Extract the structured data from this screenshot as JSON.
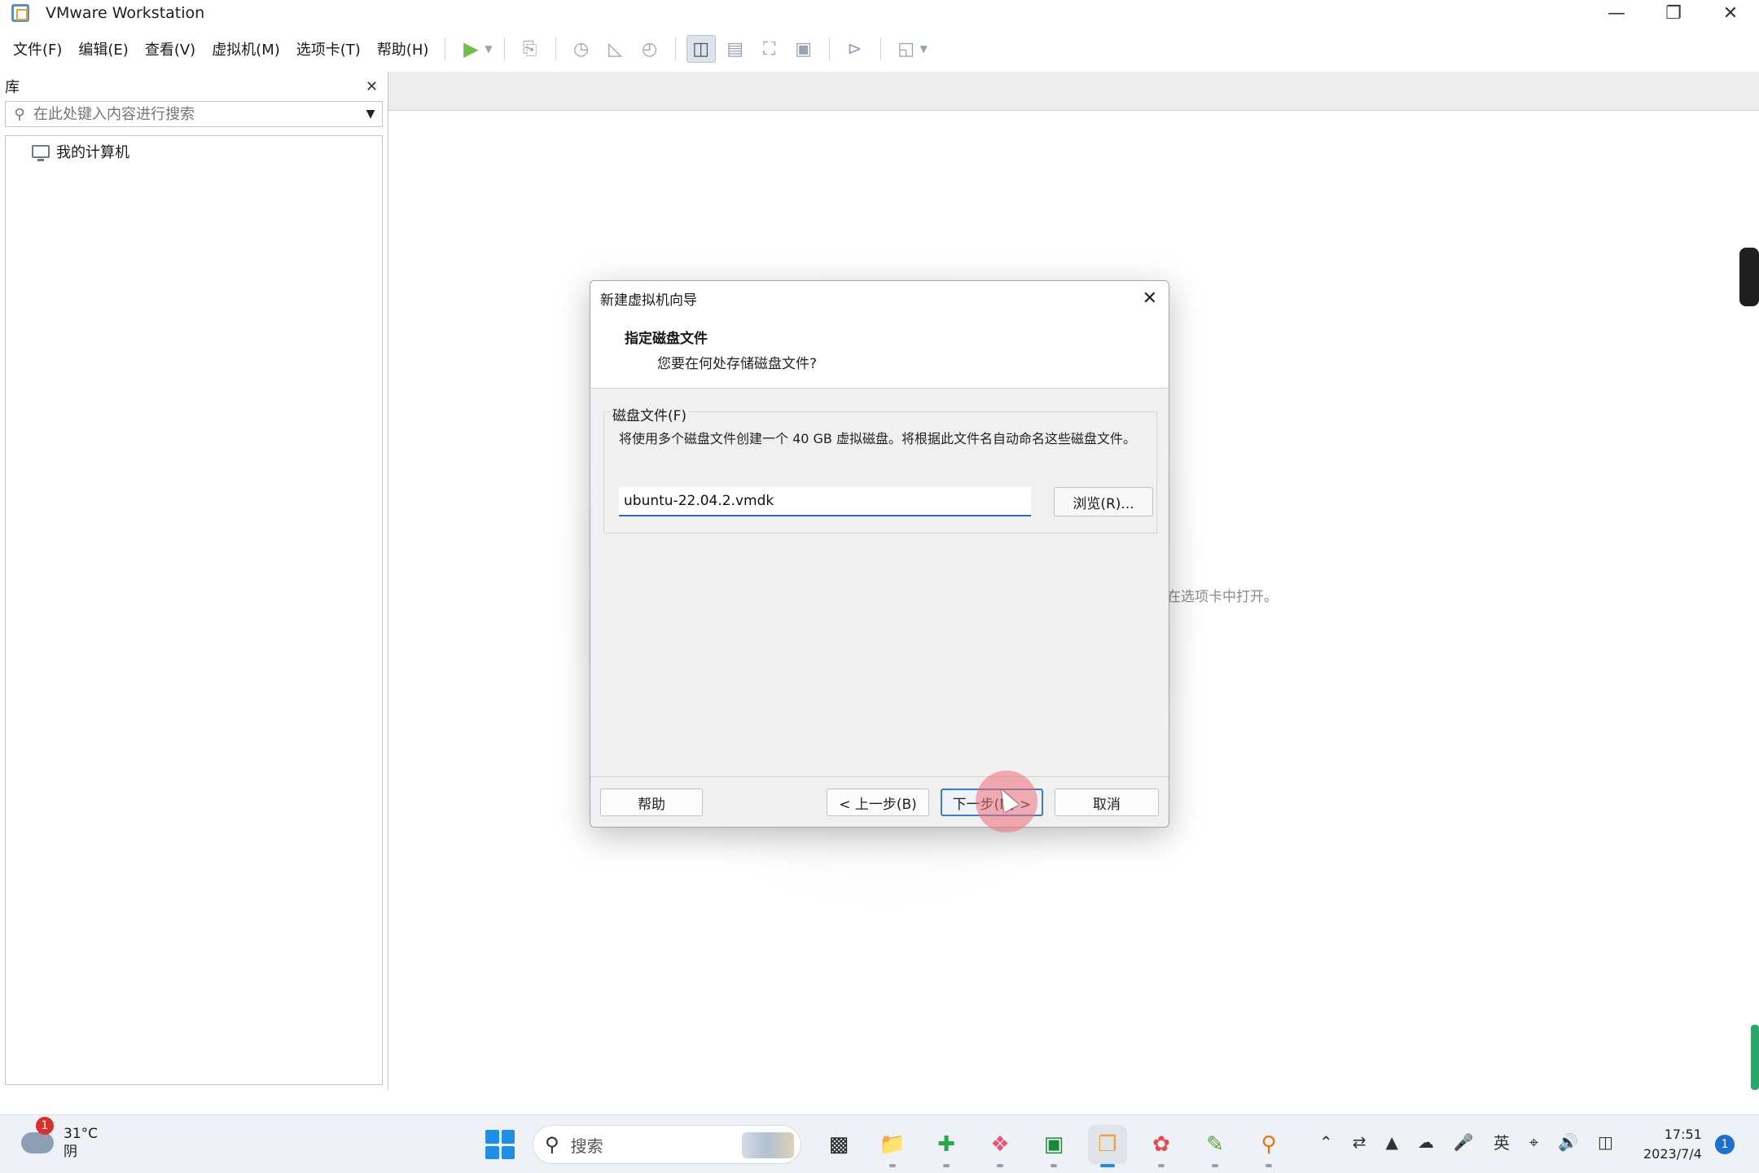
{
  "window": {
    "title": "VMware Workstation"
  },
  "menu": {
    "items": [
      "文件(F)",
      "编辑(E)",
      "查看(V)",
      "虚拟机(M)",
      "选项卡(T)",
      "帮助(H)"
    ]
  },
  "library": {
    "title": "库",
    "search_placeholder": "在此处键入内容进行搜索",
    "tree": [
      {
        "label": "我的计算机"
      }
    ]
  },
  "main": {
    "hint_fragment": "在选项卡中打开。"
  },
  "dialog": {
    "title": "新建虚拟机向导",
    "heading": "指定磁盘文件",
    "subheading": "您要在何处存储磁盘文件?",
    "group_label": "磁盘文件(F)",
    "description": "将使用多个磁盘文件创建一个 40 GB 虚拟磁盘。将根据此文件名自动命名这些磁盘文件。",
    "file_value": "ubuntu-22.04.2.vmdk",
    "browse_label": "浏览(R)...",
    "help_label": "帮助",
    "back_label": "< 上一步(B)",
    "next_label": "下一步(N) >",
    "cancel_label": "取消"
  },
  "taskbar": {
    "weather_temp": "31°C",
    "weather_desc": "阴",
    "weather_badge": "1",
    "search_label": "搜索",
    "ime": "英",
    "time": "17:51",
    "date": "2023/7/4",
    "notification_count": "1"
  },
  "icons": {
    "accent": "#1f8fe6",
    "play_color": "#6fbf4a"
  }
}
